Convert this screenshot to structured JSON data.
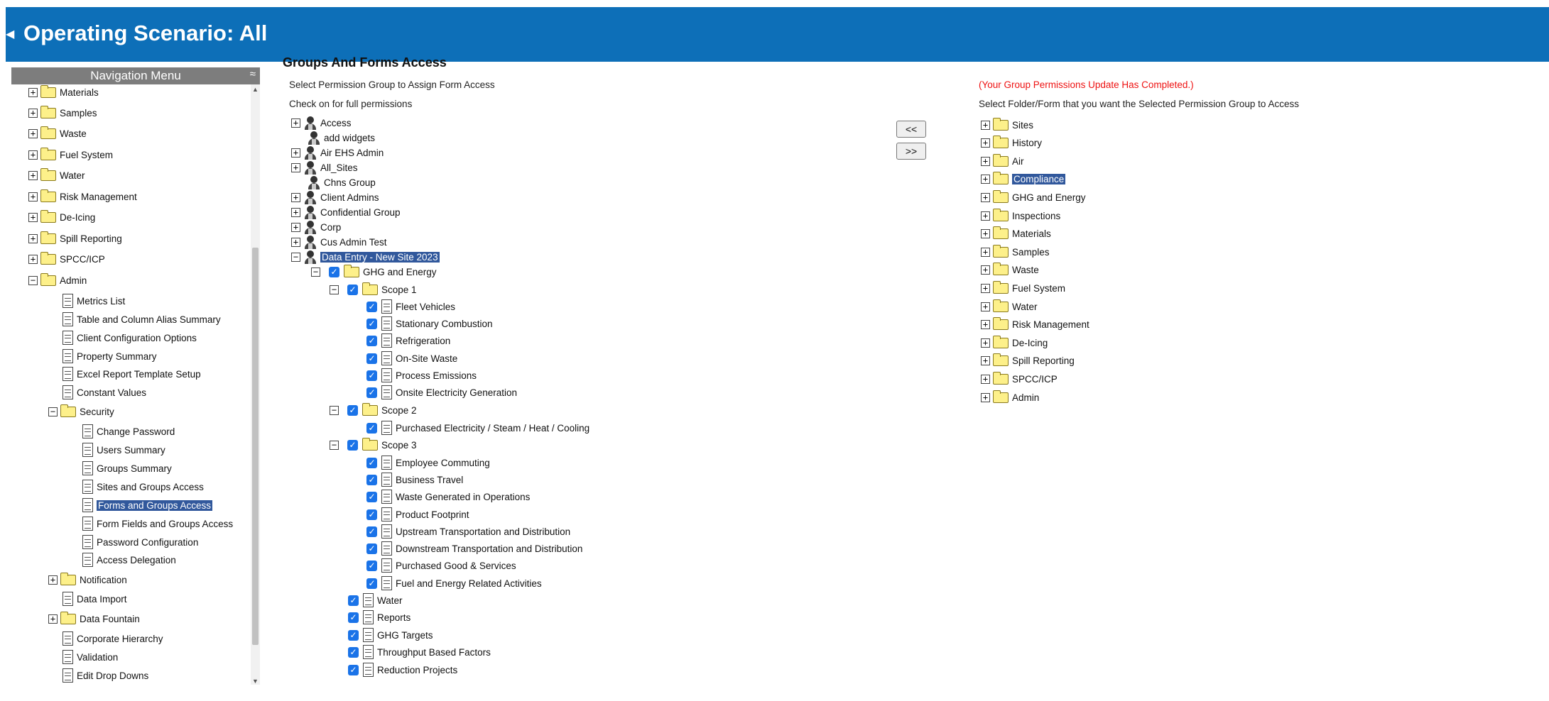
{
  "header": {
    "title": "Operating Scenario: All"
  },
  "nav": {
    "title": "Navigation Menu",
    "items": [
      {
        "label": "Materials",
        "type": "folder",
        "exp": "+"
      },
      {
        "label": "Samples",
        "type": "folder",
        "exp": "+"
      },
      {
        "label": "Waste",
        "type": "folder",
        "exp": "+"
      },
      {
        "label": "Fuel System",
        "type": "folder",
        "exp": "+"
      },
      {
        "label": "Water",
        "type": "folder",
        "exp": "+"
      },
      {
        "label": "Risk Management",
        "type": "folder",
        "exp": "+"
      },
      {
        "label": "De-Icing",
        "type": "folder",
        "exp": "+"
      },
      {
        "label": "Spill Reporting",
        "type": "folder",
        "exp": "+"
      },
      {
        "label": "SPCC/ICP",
        "type": "folder",
        "exp": "+"
      },
      {
        "label": "Admin",
        "type": "folder",
        "exp": "−"
      },
      {
        "label": "Metrics List",
        "type": "doc"
      },
      {
        "label": "Table and Column Alias Summary",
        "type": "doc"
      },
      {
        "label": "Client Configuration Options",
        "type": "doc"
      },
      {
        "label": "Property Summary",
        "type": "doc"
      },
      {
        "label": "Excel Report Template Setup",
        "type": "doc"
      },
      {
        "label": "Constant Values",
        "type": "doc"
      },
      {
        "label": "Security",
        "type": "folder",
        "exp": "−"
      },
      {
        "label": "Change Password",
        "type": "doc"
      },
      {
        "label": "Users Summary",
        "type": "doc"
      },
      {
        "label": "Groups Summary",
        "type": "doc"
      },
      {
        "label": "Sites and Groups Access",
        "type": "doc"
      },
      {
        "label": "Forms and Groups Access",
        "type": "doc",
        "selected": true
      },
      {
        "label": "Form Fields and Groups Access",
        "type": "doc"
      },
      {
        "label": "Password Configuration",
        "type": "doc"
      },
      {
        "label": "Access Delegation",
        "type": "doc"
      },
      {
        "label": "Notification",
        "type": "folder",
        "exp": "+"
      },
      {
        "label": "Data Import",
        "type": "doc"
      },
      {
        "label": "Data Fountain",
        "type": "folder",
        "exp": "+"
      },
      {
        "label": "Corporate Hierarchy",
        "type": "doc"
      },
      {
        "label": "Validation",
        "type": "doc"
      },
      {
        "label": "Edit Drop Downs",
        "type": "doc"
      }
    ]
  },
  "main": {
    "title": "Groups And Forms Access",
    "select_group_label": "Select Permission Group to Assign Form Access",
    "check_label": "Check on for full permissions",
    "update_message": "(Your Group Permissions Update Has Completed.)",
    "select_folder_label": "Select Folder/Form that you want the Selected Permission Group to Access",
    "btn_remove": "<<",
    "btn_add": ">>"
  },
  "groups": [
    {
      "label": "Access",
      "type": "user",
      "exp": "+"
    },
    {
      "label": "add widgets",
      "type": "user"
    },
    {
      "label": "Air EHS Admin",
      "type": "user",
      "exp": "+"
    },
    {
      "label": "All_Sites",
      "type": "user",
      "exp": "+"
    },
    {
      "label": "Chns Group",
      "type": "user"
    },
    {
      "label": "Client Admins",
      "type": "user",
      "exp": "+"
    },
    {
      "label": "Confidential Group",
      "type": "user",
      "exp": "+"
    },
    {
      "label": "Corp",
      "type": "user",
      "exp": "+"
    },
    {
      "label": "Cus Admin Test",
      "type": "user",
      "exp": "+"
    },
    {
      "label": "Data Entry - New Site 2023",
      "type": "user",
      "exp": "−",
      "selected": true
    },
    {
      "label": "GHG and Energy",
      "type": "folder",
      "exp": "−",
      "checked": true
    },
    {
      "label": "Scope 1",
      "type": "folder",
      "exp": "−",
      "checked": true
    },
    {
      "label": "Fleet Vehicles",
      "type": "doc",
      "checked": true
    },
    {
      "label": "Stationary Combustion",
      "type": "doc",
      "checked": true
    },
    {
      "label": "Refrigeration",
      "type": "doc",
      "checked": true
    },
    {
      "label": "On-Site Waste",
      "type": "doc",
      "checked": true
    },
    {
      "label": "Process Emissions",
      "type": "doc",
      "checked": true
    },
    {
      "label": "Onsite Electricity Generation",
      "type": "doc",
      "checked": true
    },
    {
      "label": "Scope 2",
      "type": "folder",
      "exp": "−",
      "checked": true
    },
    {
      "label": "Purchased Electricity / Steam / Heat / Cooling",
      "type": "doc",
      "checked": true
    },
    {
      "label": "Scope 3",
      "type": "folder",
      "exp": "−",
      "checked": true
    },
    {
      "label": "Employee Commuting",
      "type": "doc",
      "checked": true
    },
    {
      "label": "Business Travel",
      "type": "doc",
      "checked": true
    },
    {
      "label": "Waste Generated in Operations",
      "type": "doc",
      "checked": true
    },
    {
      "label": "Product Footprint",
      "type": "doc",
      "checked": true
    },
    {
      "label": "Upstream Transportation and Distribution",
      "type": "doc",
      "checked": true
    },
    {
      "label": "Downstream Transportation and Distribution",
      "type": "doc",
      "checked": true
    },
    {
      "label": "Purchased Good & Services",
      "type": "doc",
      "checked": true
    },
    {
      "label": "Fuel and Energy Related Activities",
      "type": "doc",
      "checked": true
    },
    {
      "label": "Water",
      "type": "doc",
      "checked": true
    },
    {
      "label": "Reports",
      "type": "doc",
      "checked": true
    },
    {
      "label": "GHG Targets",
      "type": "doc",
      "checked": true
    },
    {
      "label": "Throughput Based Factors",
      "type": "doc",
      "checked": true
    },
    {
      "label": "Reduction Projects",
      "type": "doc",
      "checked": true
    }
  ],
  "forms": [
    {
      "label": "Sites",
      "exp": "+"
    },
    {
      "label": "History",
      "exp": "+"
    },
    {
      "label": "Air",
      "exp": "+"
    },
    {
      "label": "Compliance",
      "exp": "+",
      "selected": true
    },
    {
      "label": "GHG and Energy",
      "exp": "+"
    },
    {
      "label": "Inspections",
      "exp": "+"
    },
    {
      "label": "Materials",
      "exp": "+"
    },
    {
      "label": "Samples",
      "exp": "+"
    },
    {
      "label": "Waste",
      "exp": "+"
    },
    {
      "label": "Fuel System",
      "exp": "+"
    },
    {
      "label": "Water",
      "exp": "+"
    },
    {
      "label": "Risk Management",
      "exp": "+"
    },
    {
      "label": "De-Icing",
      "exp": "+"
    },
    {
      "label": "Spill Reporting",
      "exp": "+"
    },
    {
      "label": "SPCC/ICP",
      "exp": "+"
    },
    {
      "label": "Admin",
      "exp": "+"
    }
  ]
}
